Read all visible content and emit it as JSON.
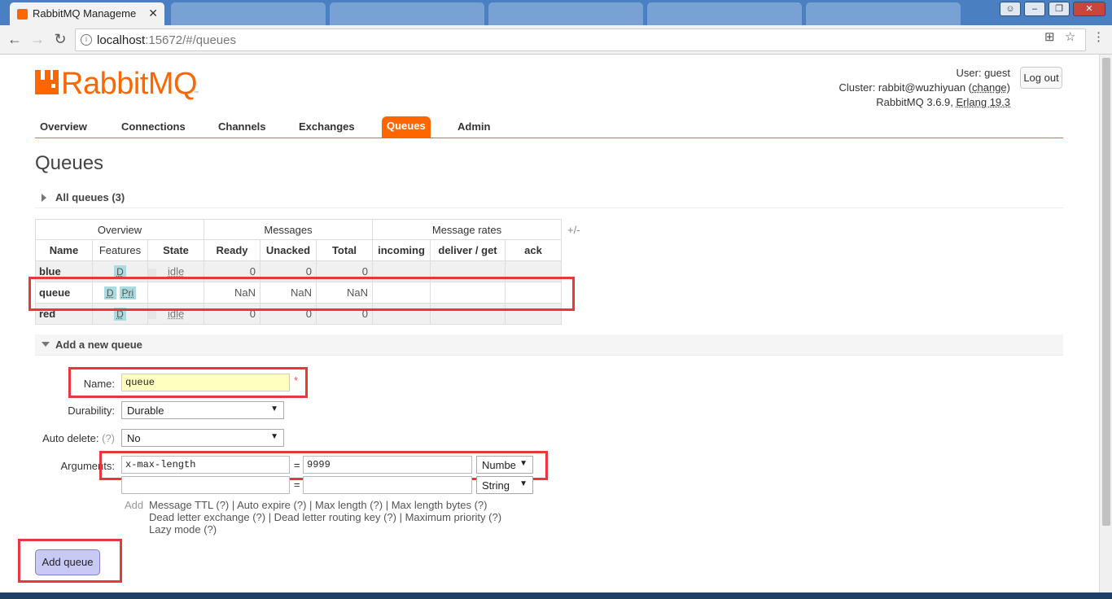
{
  "browser": {
    "active_tab_title": "RabbitMQ Manageme",
    "url_host": "localhost",
    "url_path": ":15672/#/queues"
  },
  "header": {
    "logo_text": "RabbitMQ",
    "user_label": "User: guest",
    "cluster_prefix": "Cluster: rabbit@wuzhiyuan (",
    "cluster_change": "change",
    "cluster_suffix": ")",
    "version_prefix": "RabbitMQ 3.6.9, ",
    "erlang": "Erlang 19.3",
    "logout_label": "Log out"
  },
  "nav": {
    "items": [
      "Overview",
      "Connections",
      "Channels",
      "Exchanges",
      "Queues",
      "Admin"
    ],
    "active": "Queues"
  },
  "page_title": "Queues",
  "all_queues_label": "All queues (3)",
  "table": {
    "group_headers": [
      "Overview",
      "Messages",
      "Message rates"
    ],
    "columns": [
      "Name",
      "Features",
      "State",
      "Ready",
      "Unacked",
      "Total",
      "incoming",
      "deliver / get",
      "ack"
    ],
    "plus_minus": "+/-",
    "rows": [
      {
        "name": "blue",
        "features": [
          "D"
        ],
        "state": "idle",
        "ready": "0",
        "unacked": "0",
        "total": "0"
      },
      {
        "name": "queue",
        "features": [
          "D",
          "Pri"
        ],
        "state": "",
        "ready": "NaN",
        "unacked": "NaN",
        "total": "NaN"
      },
      {
        "name": "red",
        "features": [
          "D"
        ],
        "state": "idle",
        "ready": "0",
        "unacked": "0",
        "total": "0"
      }
    ]
  },
  "add_queue": {
    "section_label": "Add a new queue",
    "name_label": "Name:",
    "name_value": "queue",
    "required_mark": "*",
    "durability_label": "Durability:",
    "durability_value": "Durable",
    "auto_delete_label": "Auto delete:",
    "auto_delete_help": "(?)",
    "auto_delete_value": "No",
    "arguments_label": "Arguments:",
    "arg1_key": "x-max-length",
    "arg1_value": "9999",
    "arg1_type": "Numbe",
    "arg2_key": "",
    "arg2_value": "",
    "arg2_type": "String",
    "equals": "=",
    "hint_add": "Add",
    "hint_line1": "Message TTL (?) | Auto expire (?) | Max length (?) | Max length bytes (?)",
    "hint_line2": "Dead letter exchange (?) | Dead letter routing key (?) | Maximum priority (?)",
    "hint_line3": "Lazy mode (?)",
    "submit_label": "Add queue"
  }
}
